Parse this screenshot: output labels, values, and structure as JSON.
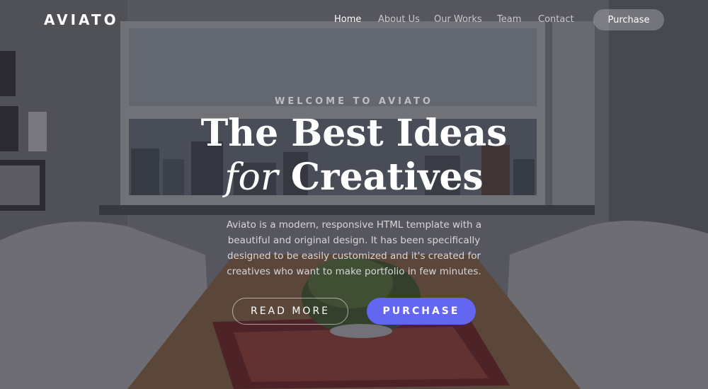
{
  "nav": {
    "logo": "AVIATO",
    "links": [
      {
        "label": "Home",
        "active": true
      },
      {
        "label": "About Us",
        "active": false
      },
      {
        "label": "Our Works",
        "active": false
      },
      {
        "label": "Team",
        "active": false
      },
      {
        "label": "Contact",
        "active": false
      }
    ],
    "purchase_label": "Purchase"
  },
  "hero": {
    "eyebrow": "WELCOME TO AVIATO",
    "headline_line1": "The Best Ideas",
    "headline_for": "for",
    "headline_rest": "Creatives",
    "description": "Aviato is a modern, responsive HTML template with a beautiful and original design. It has been specifically designed to be easily customized and it's created for creatives who want to make portfolio in few minutes.",
    "read_more_label": "READ MORE",
    "purchase_label": "PURCHASE"
  },
  "colors": {
    "accent": "#6366f1",
    "overlay": "#1e1e24"
  }
}
